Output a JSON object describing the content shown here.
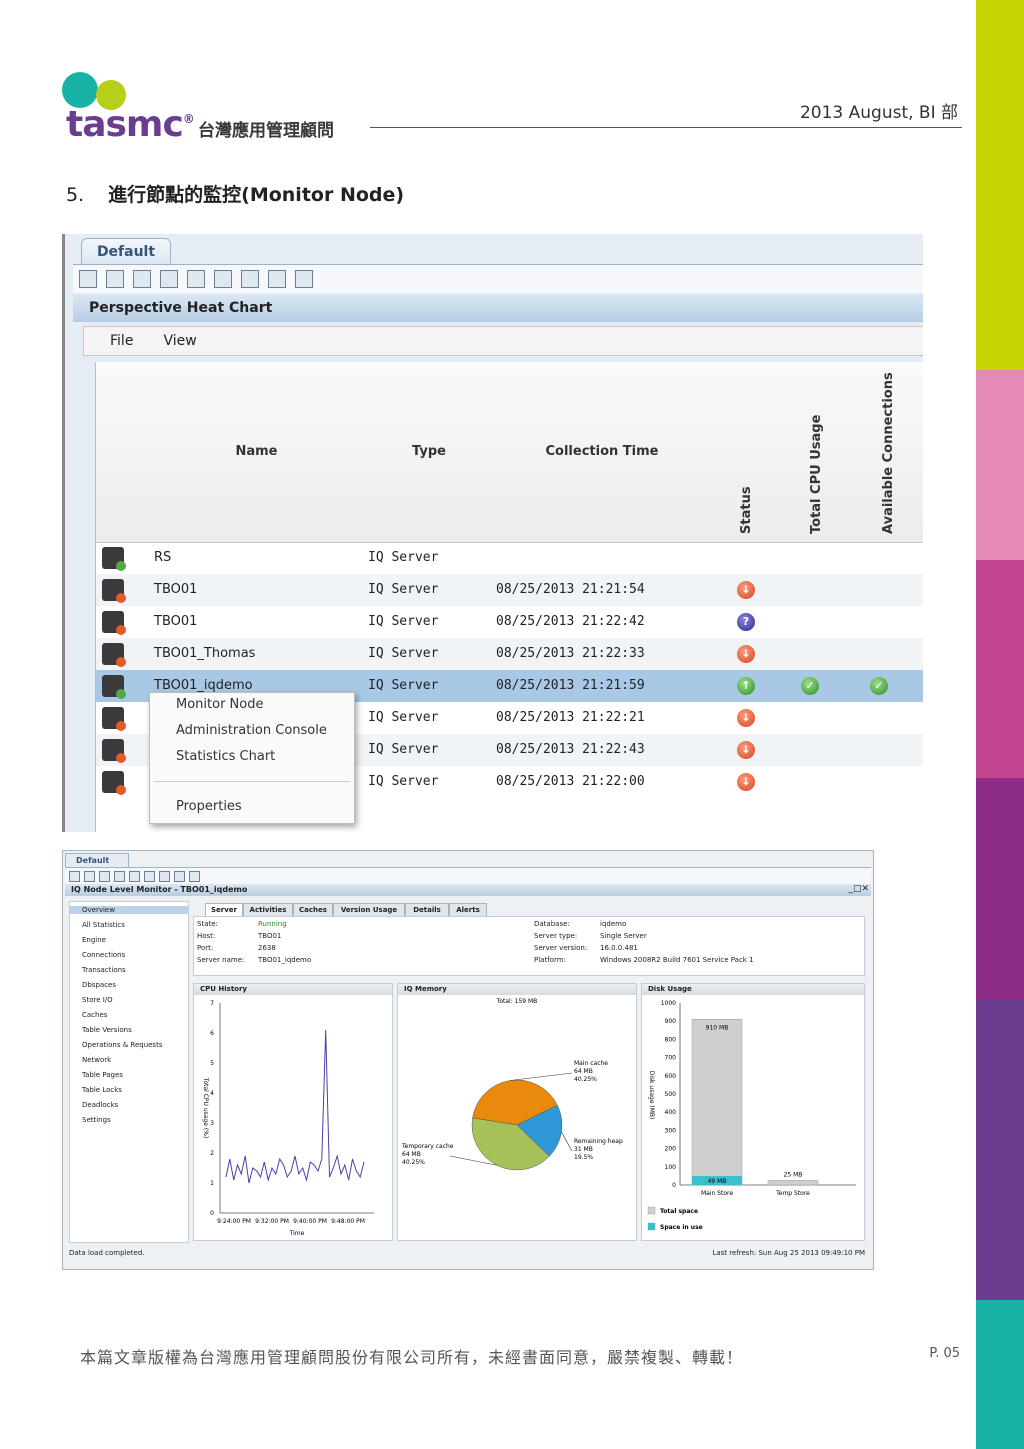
{
  "header": {
    "logo_text": "tasmc",
    "logo_mark": "®",
    "company_name": "台灣應用管理顧問",
    "date_dept": "2013  August,  BI 部"
  },
  "section": {
    "number": "5.",
    "title": "進行節點的監控(Monitor Node)"
  },
  "heat_chart": {
    "tab": "Default",
    "title": "Perspective Heat Chart",
    "menu": [
      "File",
      "View"
    ],
    "columns": {
      "name": "Name",
      "type": "Type",
      "collection_time": "Collection Time",
      "status": "Status",
      "cpu": "Total CPU Usage",
      "connections": "Available Connections"
    },
    "rows": [
      {
        "name": "RS",
        "type": "IQ Server",
        "time": ""
      },
      {
        "name": "TBO01",
        "type": "IQ Server",
        "time": "08/25/2013  21:21:54"
      },
      {
        "name": "TBO01",
        "type": "IQ Server",
        "time": "08/25/2013  21:22:42"
      },
      {
        "name": "TBO01_Thomas",
        "type": "IQ Server",
        "time": "08/25/2013  21:22:33"
      },
      {
        "name": "TBO01_iqdemo",
        "type": "IQ Server",
        "time": "08/25/2013  21:21:59"
      },
      {
        "name": "",
        "type": "IQ Server",
        "time": "08/25/2013  21:22:21"
      },
      {
        "name": "",
        "type": "IQ Server",
        "time": "08/25/2013  21:22:43"
      },
      {
        "name": "",
        "type": "IQ Server",
        "time": "08/25/2013  21:22:00"
      }
    ],
    "context_menu": [
      "Monitor Node",
      "Administration Console",
      "Statistics Chart",
      "Properties"
    ]
  },
  "node_monitor": {
    "tab": "Default",
    "title": "IQ Node Level Monitor - TBO01_iqdemo",
    "sidebar": [
      "Overview",
      "All Statistics",
      "Engine",
      "Connections",
      "Transactions",
      "Dbspaces",
      "Store I/O",
      "Caches",
      "Table Versions",
      "Operations & Requests",
      "Network",
      "Table Pages",
      "Table Locks",
      "Deadlocks",
      "Settings"
    ],
    "tabs": [
      "Server",
      "Activities",
      "Caches",
      "Version Usage",
      "Details",
      "Alerts"
    ],
    "info_left": [
      {
        "k": "State:",
        "v": "Running"
      },
      {
        "k": "Host:",
        "v": "TBO01"
      },
      {
        "k": "Port:",
        "v": "2638"
      },
      {
        "k": "Server name:",
        "v": "TBO01_iqdemo"
      }
    ],
    "info_right": [
      {
        "k": "Database:",
        "v": "iqdemo"
      },
      {
        "k": "Server type:",
        "v": "Single Server"
      },
      {
        "k": "Server version:",
        "v": "16.0.0.481"
      },
      {
        "k": "Platform:",
        "v": "Windows 2008R2 Build 7601 Service Pack 1"
      }
    ],
    "status_text": "Data load completed.",
    "refresh_text": "Last refresh: Sun Aug 25 2013 09:49:10 PM"
  },
  "chart_data": [
    {
      "type": "line",
      "title": "CPU History",
      "ylabel": "Total CPU usage (%)",
      "xlabel": "Time",
      "x_ticks": [
        "9:24:00 PM",
        "9:32:00 PM",
        "9:40:00 PM",
        "9:48:00 PM"
      ],
      "y_ticks": [
        0,
        1,
        2,
        3,
        4,
        5,
        6,
        7
      ],
      "ylim": [
        0,
        7
      ],
      "series": [
        {
          "values": [
            1.2,
            1.8,
            1.1,
            1.6,
            1.3,
            1.9,
            1.0,
            1.5,
            1.4,
            1.2,
            1.7,
            1.1,
            1.5,
            1.3,
            1.8,
            1.6,
            1.2,
            1.4,
            1.9,
            1.3,
            1.5,
            1.1,
            1.7,
            1.6,
            1.4,
            1.8,
            6.1,
            1.2,
            1.5,
            1.9,
            1.3,
            1.6,
            1.1,
            1.8,
            1.4,
            1.2,
            1.7
          ]
        }
      ]
    },
    {
      "type": "pie",
      "title": "IQ Memory",
      "subtitle": "Total: 159 MB",
      "slices": [
        {
          "label": "Main cache",
          "value_label": "64 MB",
          "pct_label": "40.25%",
          "value": 64,
          "color": "#e98a0c"
        },
        {
          "label": "Remaining heap",
          "value_label": "31 MB",
          "pct_label": "19.5%",
          "value": 31,
          "color": "#2f99d8"
        },
        {
          "label": "Temporary cache",
          "value_label": "64 MB",
          "pct_label": "40.25%",
          "value": 64,
          "color": "#a8c25a"
        }
      ]
    },
    {
      "type": "bar",
      "title": "Disk Usage",
      "ylabel": "Disk usage (MB)",
      "categories": [
        "Main Store",
        "Temp Store"
      ],
      "y_ticks": [
        0,
        100,
        200,
        300,
        400,
        500,
        600,
        700,
        800,
        900,
        1000
      ],
      "ylim": [
        0,
        1000
      ],
      "series": [
        {
          "name": "Total space",
          "values": [
            910,
            25
          ],
          "labels": [
            "910 MB",
            "25 MB"
          ],
          "color": "#cfcfcf"
        },
        {
          "name": "Space in use",
          "values": [
            49,
            0
          ],
          "labels": [
            "49 MB",
            ""
          ],
          "color": "#39bfd0"
        }
      ]
    }
  ],
  "footer": {
    "copyright": "本篇文章版權為台灣應用管理顧問股份有限公司所有，未經書面同意，嚴禁複製、轉載！",
    "page": "P. 05"
  }
}
